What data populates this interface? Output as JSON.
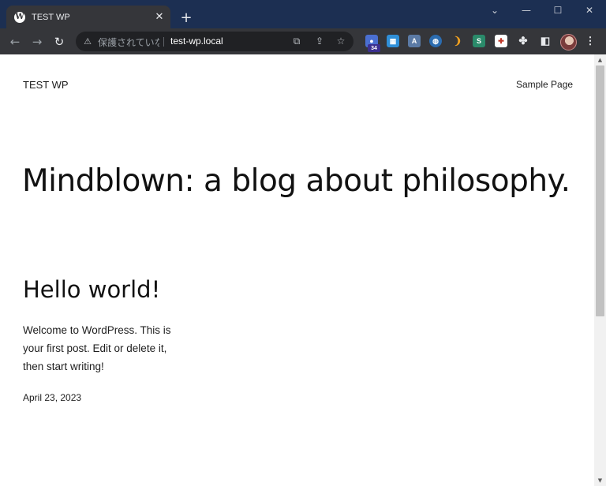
{
  "tab": {
    "title": "TEST WP",
    "favicon": "wordpress-icon",
    "close_glyph": "✕"
  },
  "new_tab_glyph": "+",
  "window_controls": {
    "dropdown": "⌄",
    "minimize": "—",
    "maximize": "☐",
    "close": "✕"
  },
  "toolbar": {
    "back": "←",
    "forward": "→",
    "reload": "↻",
    "security_label": "保護されていない通信",
    "url": "test-wp.local",
    "extension_badge": "34"
  },
  "page": {
    "site_title": "TEST WP",
    "nav_link": "Sample Page",
    "hero_heading": "Mindblown: a blog about philosophy.",
    "post": {
      "title": "Hello world!",
      "excerpt_lines": [
        "Welcome to WordPress. This is",
        "your first post. Edit or delete it,",
        "then start writing!"
      ],
      "date": "April 23, 2023"
    }
  },
  "colors": {
    "frame": "#1c2f52",
    "toolbar": "#35363a",
    "omnibox": "#202124",
    "page_bg": "#ffffff",
    "text": "#111111"
  }
}
